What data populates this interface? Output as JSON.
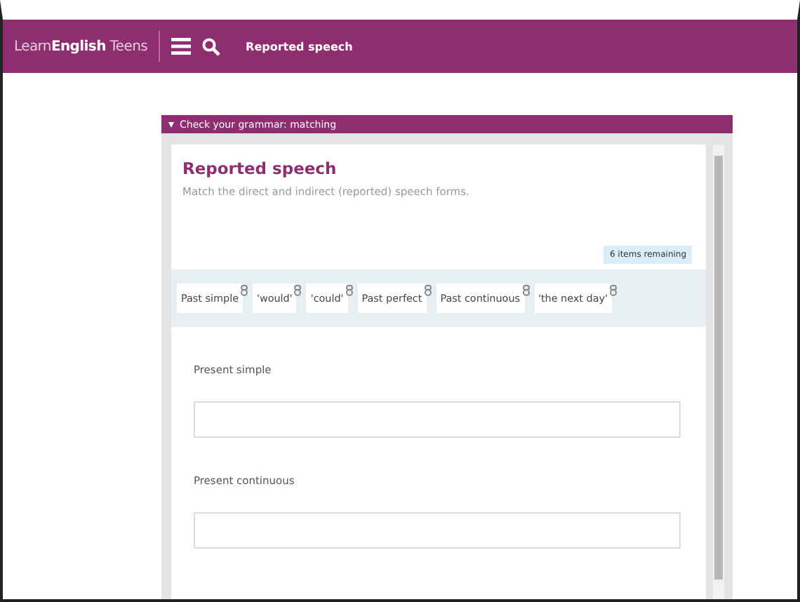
{
  "header": {
    "logo": "Learn**English** Teens",
    "page_title": "Reported speech"
  },
  "panel": {
    "title": "Check your grammar: matching",
    "expanded": true
  },
  "exercise": {
    "title": "Reported speech",
    "instructions": "Match the direct and indirect (reported) speech forms.",
    "remaining": "6 items remaining",
    "items": [
      "Past simple",
      "'would'",
      "'could'",
      "Past perfect",
      "Past continuous",
      "'the next day'"
    ],
    "targets": [
      {
        "label": "Present simple"
      },
      {
        "label": "Present continuous"
      }
    ]
  }
}
